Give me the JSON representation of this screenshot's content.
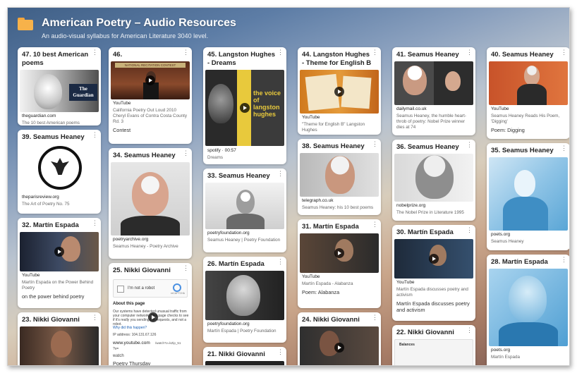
{
  "header": {
    "title": "American Poetry – Audio Resources",
    "subtitle": "An audio-visual syllabus for American Literature 3040 level."
  },
  "menu_glyph": "⋮",
  "cards": {
    "c47": {
      "title": "47. 10 best American poems",
      "source": "theguardian.com",
      "desc": "The 10 best American poems",
      "brand": "The Guardian"
    },
    "c39": {
      "title": "39. Seamus Heaney",
      "source": "theparisreview.org",
      "desc": "The Art of Poetry No. 75"
    },
    "c32": {
      "title": "32.  Martín Espada",
      "source": "YouTube",
      "desc": "Martín Espada on the Power Behind Poetry",
      "note": "on the power behind poetry"
    },
    "c23": {
      "title": "23. Nikki Giovanni"
    },
    "c46": {
      "title": "46.",
      "banner": "NATIONAL RECITATION CONTEST",
      "source": "YouTube",
      "desc": "California Poetry Out Loud 2010 Cheryl Evans of Contra Costa County Rd. 3",
      "note": "Contest"
    },
    "c34": {
      "title": "34. Seamus Heaney",
      "source": "poetryarchive.org",
      "desc": "Seamus Heaney - Poetry Archive"
    },
    "c25": {
      "title": "25. Nikki Giovanni",
      "captcha": "I'm not a robot",
      "captcha_brand": "reCAPTCHA",
      "about_title": "About this page",
      "about_text": "Our systems have detected unusual traffic from your computer network. This page checks to see if it's really you sending the requests, and not a robot.",
      "about_link": "Why did this happen?",
      "ip": "IP address: 104.131.67.126",
      "source": "www.youtube.com",
      "url_tail": "/watch?v=kZip_51",
      "url_prefix": "?v=",
      "watch": "watch",
      "note": "Poetry Thursday"
    },
    "c45": {
      "title": "45. Langston Hughes - Dreams",
      "cover_text": "the voice of langston hughes",
      "source": "spotify",
      "duration": "00:57",
      "desc": "Dreams"
    },
    "c33": {
      "title": "33. Seamus Heaney",
      "source": "poetryfoundation.org",
      "desc": "Seamus Heaney | Poetry Foundation"
    },
    "c26": {
      "title": "26. Martín Espada",
      "source": "poetryfoundation.org",
      "desc": "Martín Espada | Poetry Foundation"
    },
    "c21": {
      "title": "21. Nikki Giovanni"
    },
    "c44": {
      "title": "44. Langston Hughes - Theme for English B",
      "source": "YouTube",
      "desc": "\"Theme for English B\" Langston Hughes"
    },
    "c38": {
      "title": "38. Seamus Heaney",
      "source": "telegraph.co.uk",
      "desc": "Seamus Heaney: his 10 best poems"
    },
    "c31": {
      "title": "31.  Martín Espada",
      "source": "YouTube",
      "desc": "Martín Espada - Alabanza",
      "note": "Poem: Alabanza"
    },
    "c24": {
      "title": "24. Nikki Giovanni"
    },
    "c41": {
      "title": "41. Seamus Heaney",
      "source": "dailymail.co.uk",
      "desc": "Seamus Heaney, the humble heart-throb of poetry: Nobel Prize winner dies at 74"
    },
    "c36": {
      "title": "36. Seamus Heaney",
      "source": "nobelprize.org",
      "desc": "The Nobel Prize in Literature 1995"
    },
    "c30": {
      "title": "30.  Martín Espada",
      "source": "YouTube",
      "desc": "Martín Espada discusses poetry and activism",
      "note": "Martín Espada discusses poetry and activism"
    },
    "c22": {
      "title": "22. Nikki Giovanni",
      "doc_text": "Balances"
    },
    "c40": {
      "title": "40. Seamus Heaney",
      "source": "YouTube",
      "desc": "Seamus Heaney Reads His Poem, 'Digging'",
      "note": "Poem: Digging"
    },
    "c35": {
      "title": "35. Seamus Heaney",
      "source": "poets.org",
      "desc": "Seamus Heaney"
    },
    "c28": {
      "title": "28.  Martín Espada",
      "source": "poets.org",
      "desc": "Martín Espada"
    }
  },
  "colors": {
    "card_bg": "#ffffff",
    "folder": "#f7b24a",
    "title_text": "#ffffff"
  }
}
